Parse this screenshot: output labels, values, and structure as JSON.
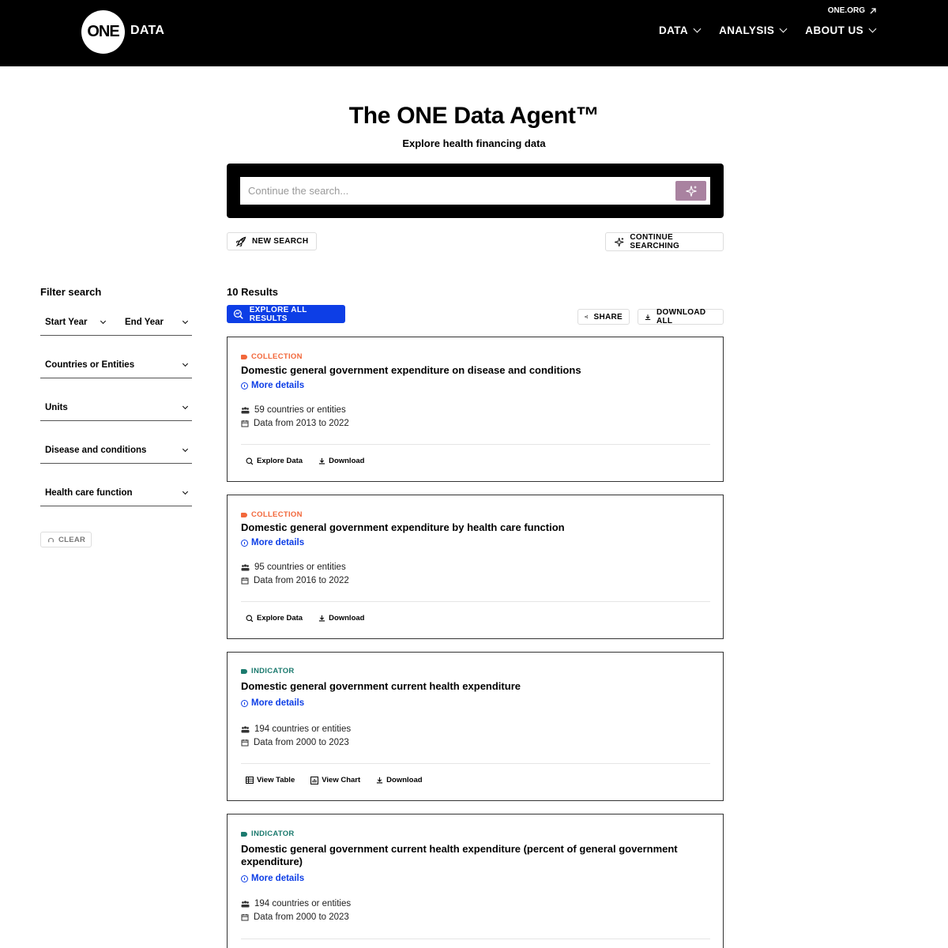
{
  "header": {
    "logo_text": "ONE",
    "logo_suffix": "DATA",
    "external_link": "ONE.ORG",
    "nav": [
      {
        "label": "DATA"
      },
      {
        "label": "ANALYSIS"
      },
      {
        "label": "ABOUT US"
      }
    ]
  },
  "hero": {
    "title": "The ONE Data Agent™",
    "subtitle": "Explore health financing data"
  },
  "search": {
    "placeholder": "Continue the search...",
    "value": "",
    "new_search_label": "NEW SEARCH",
    "continue_label": "CONTINUE SEARCHING"
  },
  "filters": {
    "title": "Filter search",
    "start_year": "Start Year",
    "end_year": "End Year",
    "items": [
      {
        "label": "Countries or Entities"
      },
      {
        "label": "Units"
      },
      {
        "label": "Disease and conditions"
      },
      {
        "label": "Health care function"
      }
    ],
    "clear_label": "CLEAR"
  },
  "results": {
    "count_label": "10 Results",
    "explore_all_label": "EXPLORE ALL RESULTS",
    "share_label": "SHARE",
    "download_all_label": "DOWNLOAD ALL",
    "more_details_label": "More details",
    "cards": [
      {
        "type": "COLLECTION",
        "type_color": "#f2673a",
        "title": "Domestic general government expenditure on disease and conditions",
        "countries": "59 countries or entities",
        "years": "Data from 2013 to 2022",
        "actions": [
          "Explore Data",
          "Download"
        ]
      },
      {
        "type": "COLLECTION",
        "type_color": "#f2673a",
        "title": "Domestic general government expenditure by health care function",
        "countries": "95 countries or entities",
        "years": "Data from 2016 to 2022",
        "actions": [
          "Explore Data",
          "Download"
        ]
      },
      {
        "type": "INDICATOR",
        "type_color": "#1b7a6e",
        "title": "Domestic general government current health expenditure",
        "countries": "194 countries or entities",
        "years": "Data from 2000 to 2023",
        "actions": [
          "View Table",
          "View Chart",
          "Download"
        ]
      },
      {
        "type": "INDICATOR",
        "type_color": "#1b7a6e",
        "title": "Domestic general government current health expenditure (percent of general government expenditure)",
        "countries": "194 countries or entities",
        "years": "Data from 2000 to 2023",
        "actions": []
      }
    ]
  },
  "colors": {
    "accent_blue": "#0d3ee6",
    "search_button": "#a982a0",
    "collection": "#f2673a",
    "indicator": "#1b7a6e"
  }
}
